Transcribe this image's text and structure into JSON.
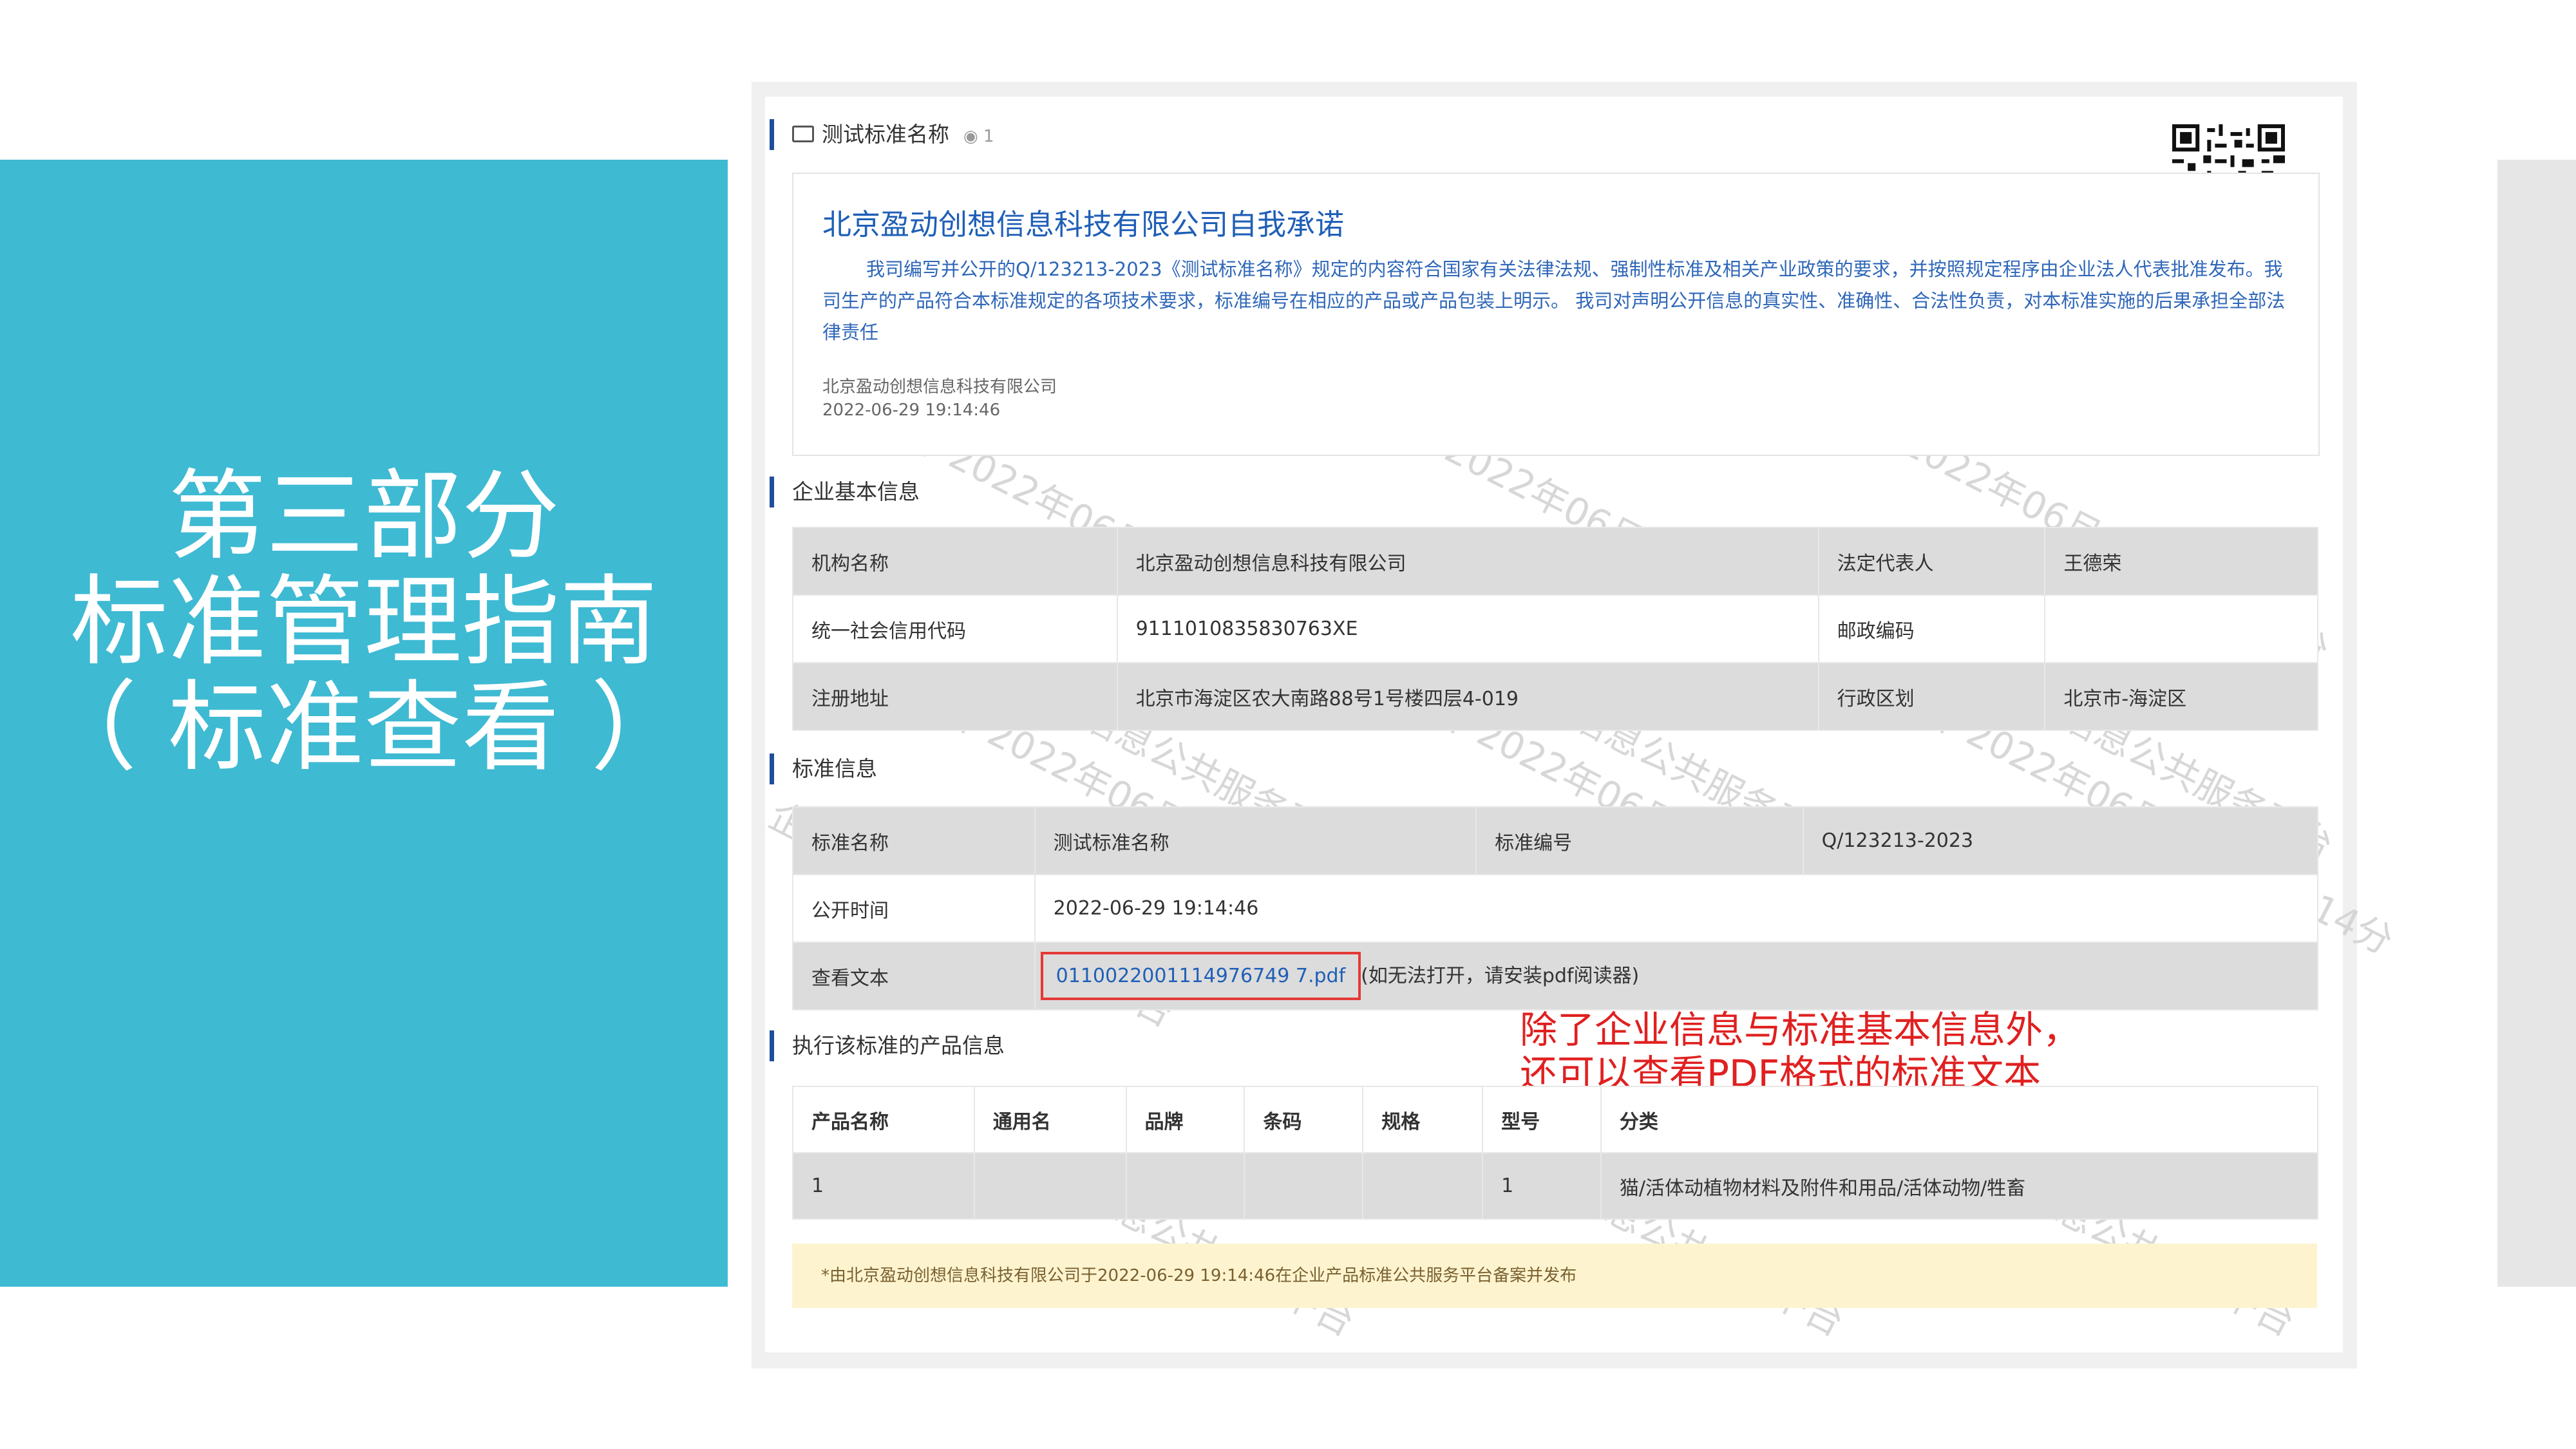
{
  "slide": {
    "title_lines": [
      "第三部分",
      "标准管理指南",
      "（ 标准查看 ）"
    ]
  },
  "page": {
    "header": {
      "std_name": "测试标准名称",
      "view_icon": "eye-icon",
      "view_count": "1"
    },
    "promise": {
      "title": "北京盈动创想信息科技有限公司自我承诺",
      "body": "我司编写并公开的Q/123213-2023《测试标准名称》规定的内容符合国家有关法律法规、强制性标准及相关产业政策的要求，并按照规定程序由企业法人代表批准发布。我司生产的产品符合本标准规定的各项技术要求，标准编号在相应的产品或产品包装上明示。 我司对声明公开信息的真实性、准确性、合法性负责，对本标准实施的后果承担全部法律责任",
      "company": "北京盈动创想信息科技有限公司",
      "time": "2022-06-29 19:14:46"
    },
    "company_section": {
      "heading": "企业基本信息",
      "rows": [
        {
          "k1": "机构名称",
          "v1": "北京盈动创想信息科技有限公司",
          "k2": "法定代表人",
          "v2": "王德荣"
        },
        {
          "k1": "统一社会信用代码",
          "v1": "9111010835830763XE",
          "k2": "邮政编码",
          "v2": ""
        },
        {
          "k1": "注册地址",
          "v1": "北京市海淀区农大南路88号1号楼四层4-019",
          "k2": "行政区划",
          "v2": "北京市-海淀区"
        }
      ]
    },
    "standard_section": {
      "heading": "标准信息",
      "name_label": "标准名称",
      "name_value": "测试标准名称",
      "code_label": "标准编号",
      "code_value": "Q/123213-2023",
      "pub_label": "公开时间",
      "pub_value": "2022-06-29 19:14:46",
      "text_label": "查看文本",
      "pdf_file": "0110022001114976749 7.pdf",
      "pdf_hint": "(如无法打开，请安装pdf阅读器)"
    },
    "product_section": {
      "heading": "执行该标准的产品信息",
      "columns": [
        "产品名称",
        "通用名",
        "品牌",
        "条码",
        "规格",
        "型号",
        "分类"
      ],
      "rows": [
        [
          "1",
          "",
          "",
          "",
          "",
          "1",
          "猫/活体动植物材料及附件和用品/活体动物/牲畜"
        ]
      ]
    },
    "footer": "*由北京盈动创想信息科技有限公司于2022-06-29 19:14:46在企业产品标准公共服务平台备案并发布",
    "annotation": [
      "除了企业信息与标准基本信息外，",
      "还可以查看PDF格式的标准文本"
    ],
    "watermark": [
      "企业标准信息公共服务平台",
      "公开 2022年06月29日19时14分"
    ]
  },
  "colors": {
    "accent_panel": "#3ebad3",
    "link_blue": "#1f5fb7",
    "highlight_red": "#e53935",
    "footer_bg": "#fdf4cf"
  }
}
